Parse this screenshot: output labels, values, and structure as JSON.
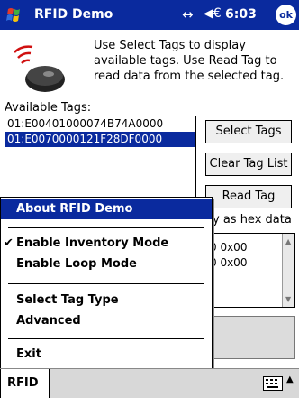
{
  "titlebar": {
    "title": "RFID Demo",
    "time": "6:03",
    "ok_label": "ok",
    "icons": [
      "windows-start-icon",
      "connectivity-icon",
      "volume-icon"
    ]
  },
  "content": {
    "instructions": "Use Select Tags to display available tags.  Use Read Tag to read data from the selected tag.",
    "tags_label": "Available Tags:",
    "tags": [
      {
        "id": "01:E00401000074B74A0000",
        "selected": false
      },
      {
        "id": "01:E0070000121F28DF0000",
        "selected": true
      }
    ],
    "buttons": {
      "select": "Select Tags",
      "clear": "Clear Tag List",
      "read": "Read Tag"
    },
    "hex_label_partial": "y as hex data",
    "data_rows": [
      "0 0x00",
      "0 0x00"
    ]
  },
  "menu": {
    "items": {
      "about": "About RFID Demo",
      "inventory": "Enable Inventory Mode",
      "loop": "Enable Loop Mode",
      "tag_type": "Select Tag Type",
      "advanced": "Advanced",
      "exit": "Exit"
    },
    "inventory_checked": true,
    "check_glyph": "✔"
  },
  "bottombar": {
    "menu_label": "RFID",
    "icons": [
      "keyboard-icon",
      "input-arrow-icon"
    ]
  },
  "colors": {
    "accent": "#0a2a9e",
    "background": "#ffffff",
    "button": "#efefef"
  }
}
